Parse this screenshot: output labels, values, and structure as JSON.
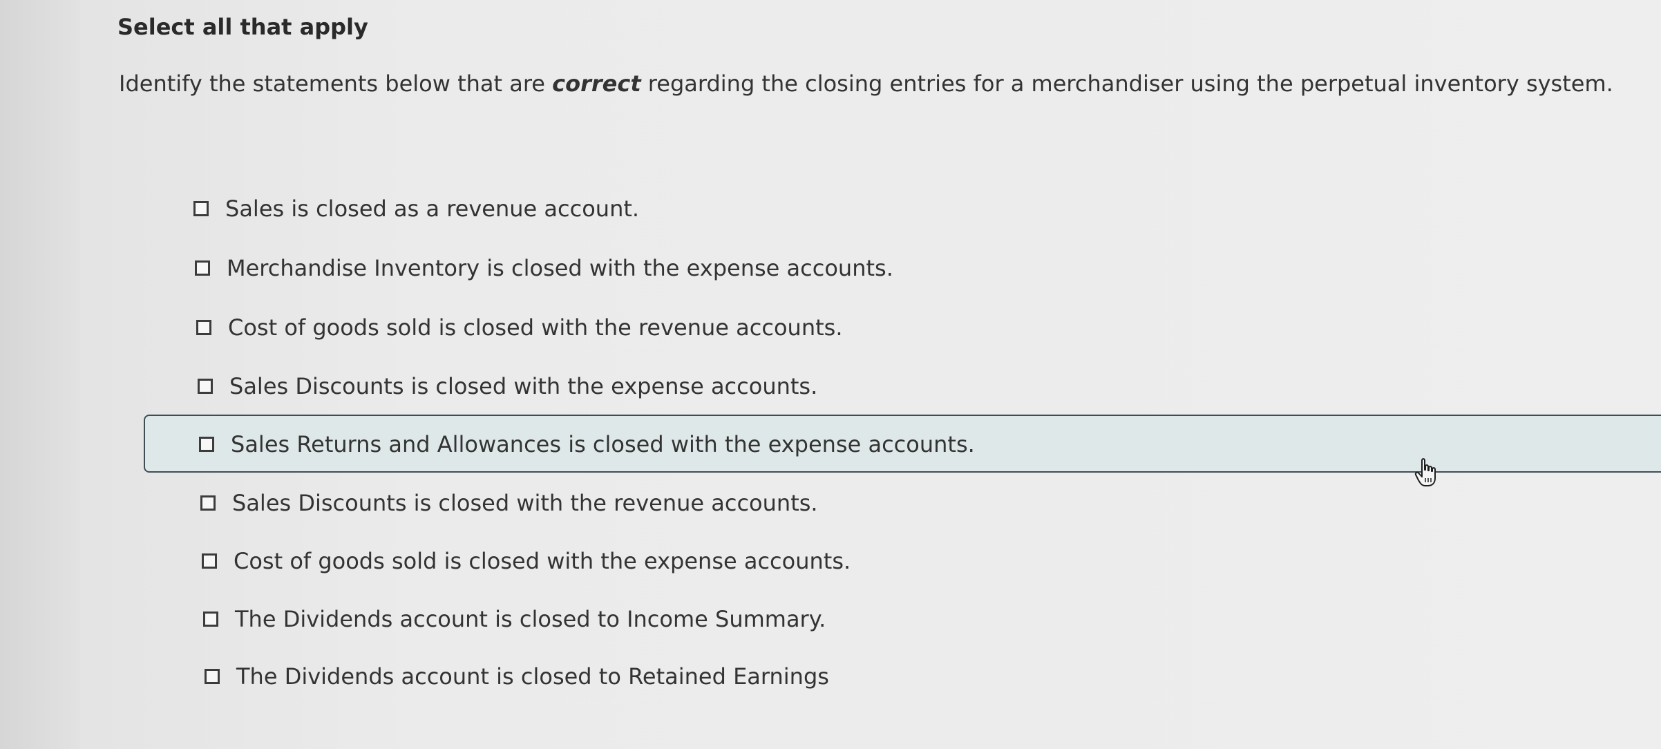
{
  "question": {
    "heading": "Select all that apply",
    "prompt_before": "Identify the statements below that are ",
    "prompt_emphasis": "correct",
    "prompt_after": " regarding the closing entries for a merchandiser using the perpetual inventory system."
  },
  "options": [
    {
      "label": "Sales is closed as a revenue account.",
      "checked": false
    },
    {
      "label": "Merchandise Inventory is closed with the expense accounts.",
      "checked": false
    },
    {
      "label": "Cost of goods sold is closed with the revenue accounts.",
      "checked": false
    },
    {
      "label": "Sales Discounts is closed with the expense accounts.",
      "checked": false
    },
    {
      "label": "Sales Returns and Allowances is closed with the expense accounts.",
      "checked": false,
      "hovered": true
    },
    {
      "label": "Sales Discounts is closed with the revenue accounts.",
      "checked": false
    },
    {
      "label": "Cost of goods sold is closed with the expense accounts.",
      "checked": false
    },
    {
      "label": "The Dividends account is closed to Income Summary.",
      "checked": false
    },
    {
      "label": "The Dividends account is closed to Retained Earnings",
      "checked": false
    }
  ],
  "cursor": {
    "icon": "hand-pointer-icon"
  }
}
